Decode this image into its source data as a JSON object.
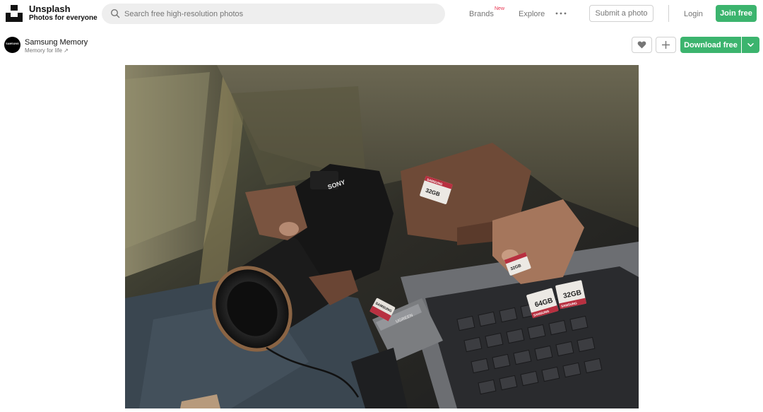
{
  "header": {
    "brand_title": "Unsplash",
    "brand_subtitle": "Photos for everyone",
    "search_placeholder": "Search free high-resolution photos",
    "nav": {
      "brands": "Brands",
      "brands_badge": "New",
      "explore": "Explore",
      "submit": "Submit a photo",
      "login": "Login",
      "join": "Join free"
    }
  },
  "photo_bar": {
    "avatar_text": "SAMSUNG",
    "author_name": "Samsung Memory",
    "author_sub": "Memory for life ↗",
    "download_label": "Download free"
  },
  "photo": {
    "camera_brand": "SONY",
    "card_brand": "SAMSUNG",
    "card_32": "32GB",
    "card_64": "64GB",
    "reader_brand": "SAMSUNG",
    "reader_label": "UGREEN"
  },
  "colors": {
    "accent": "#3cb46e",
    "badge": "#e8324f",
    "muted": "#767676"
  }
}
